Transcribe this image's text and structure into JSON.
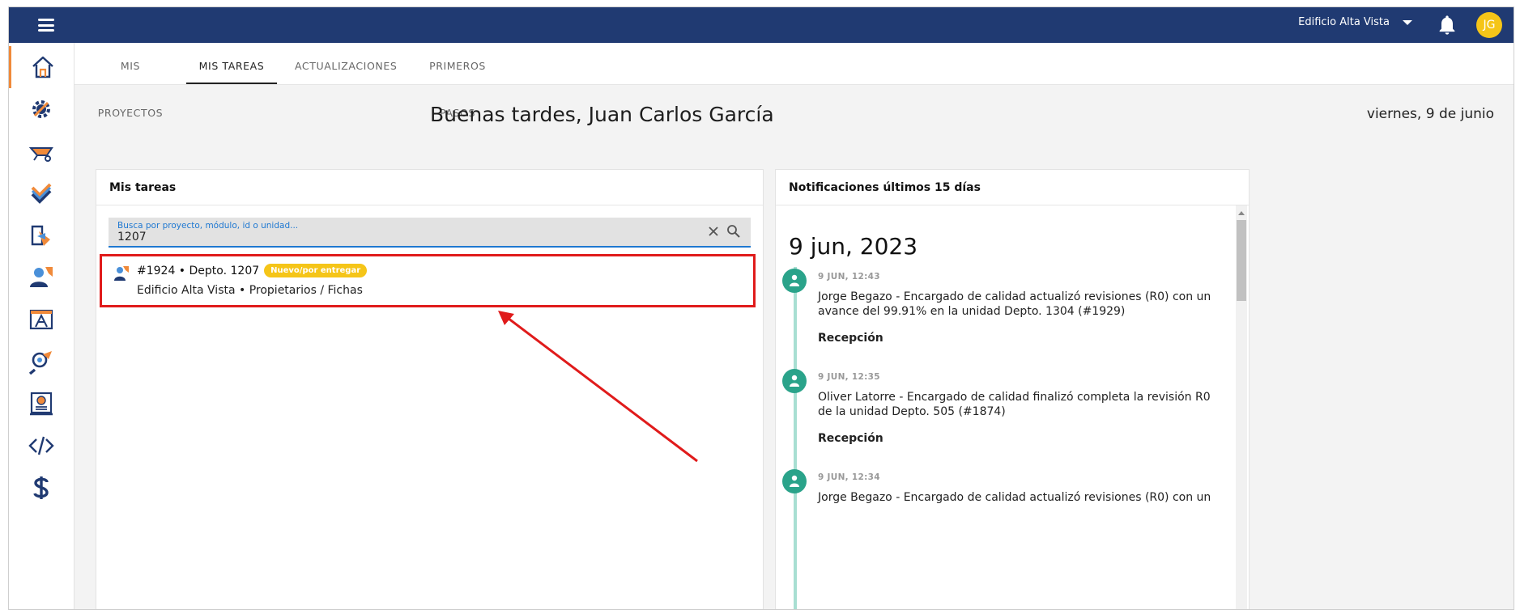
{
  "topbar": {
    "project": "Edificio Alta Vista",
    "avatar_initials": "JG"
  },
  "sidebar": {
    "items": [
      {
        "name": "home"
      },
      {
        "name": "settings"
      },
      {
        "name": "wheelbarrow"
      },
      {
        "name": "tasks"
      },
      {
        "name": "transfer"
      },
      {
        "name": "users"
      },
      {
        "name": "blueprint"
      },
      {
        "name": "inspection"
      },
      {
        "name": "certificate"
      },
      {
        "name": "code"
      },
      {
        "name": "billing"
      }
    ]
  },
  "tabs": [
    {
      "label": "MIS PROYECTOS"
    },
    {
      "label": "MIS TAREAS"
    },
    {
      "label": "ACTUALIZACIONES"
    },
    {
      "label": "PRIMEROS PASOS"
    }
  ],
  "greeting": "Buenas tardes, Juan Carlos García",
  "date": "viernes, 9 de junio",
  "tasks": {
    "title": "Mis tareas",
    "search": {
      "placeholder": "Busca por proyecto, módulo, id o unidad...",
      "value": "1207"
    },
    "results": [
      {
        "id_unit": "#1924 • Depto. 1207",
        "badge": "Nuevo/por entregar",
        "subtitle": "Edificio Alta Vista • Propietarios / Fichas"
      }
    ]
  },
  "notifications": {
    "title": "Notificaciones últimos 15 días",
    "date_heading": "9 jun, 2023",
    "items": [
      {
        "time": "9 JUN, 12:43",
        "text": "Jorge Begazo - Encargado de calidad actualizó revisiones (R0) con un avance del 99.91% en la unidad Depto. 1304 (#1929)",
        "tag": "Recepción"
      },
      {
        "time": "9 JUN, 12:35",
        "text": "Oliver Latorre - Encargado de calidad finalizó completa la revisión R0 de la unidad Depto. 505 (#1874)",
        "tag": "Recepción"
      },
      {
        "time": "9 JUN, 12:34",
        "text": "Jorge Begazo - Encargado de calidad actualizó revisiones (R0) con un",
        "tag": ""
      }
    ]
  },
  "colors": {
    "topbar": "#203a72",
    "accent_orange": "#f08a3a",
    "highlight_red": "#e01b1b",
    "badge_yellow": "#f5c518",
    "timeline_teal": "#2aa38a"
  }
}
